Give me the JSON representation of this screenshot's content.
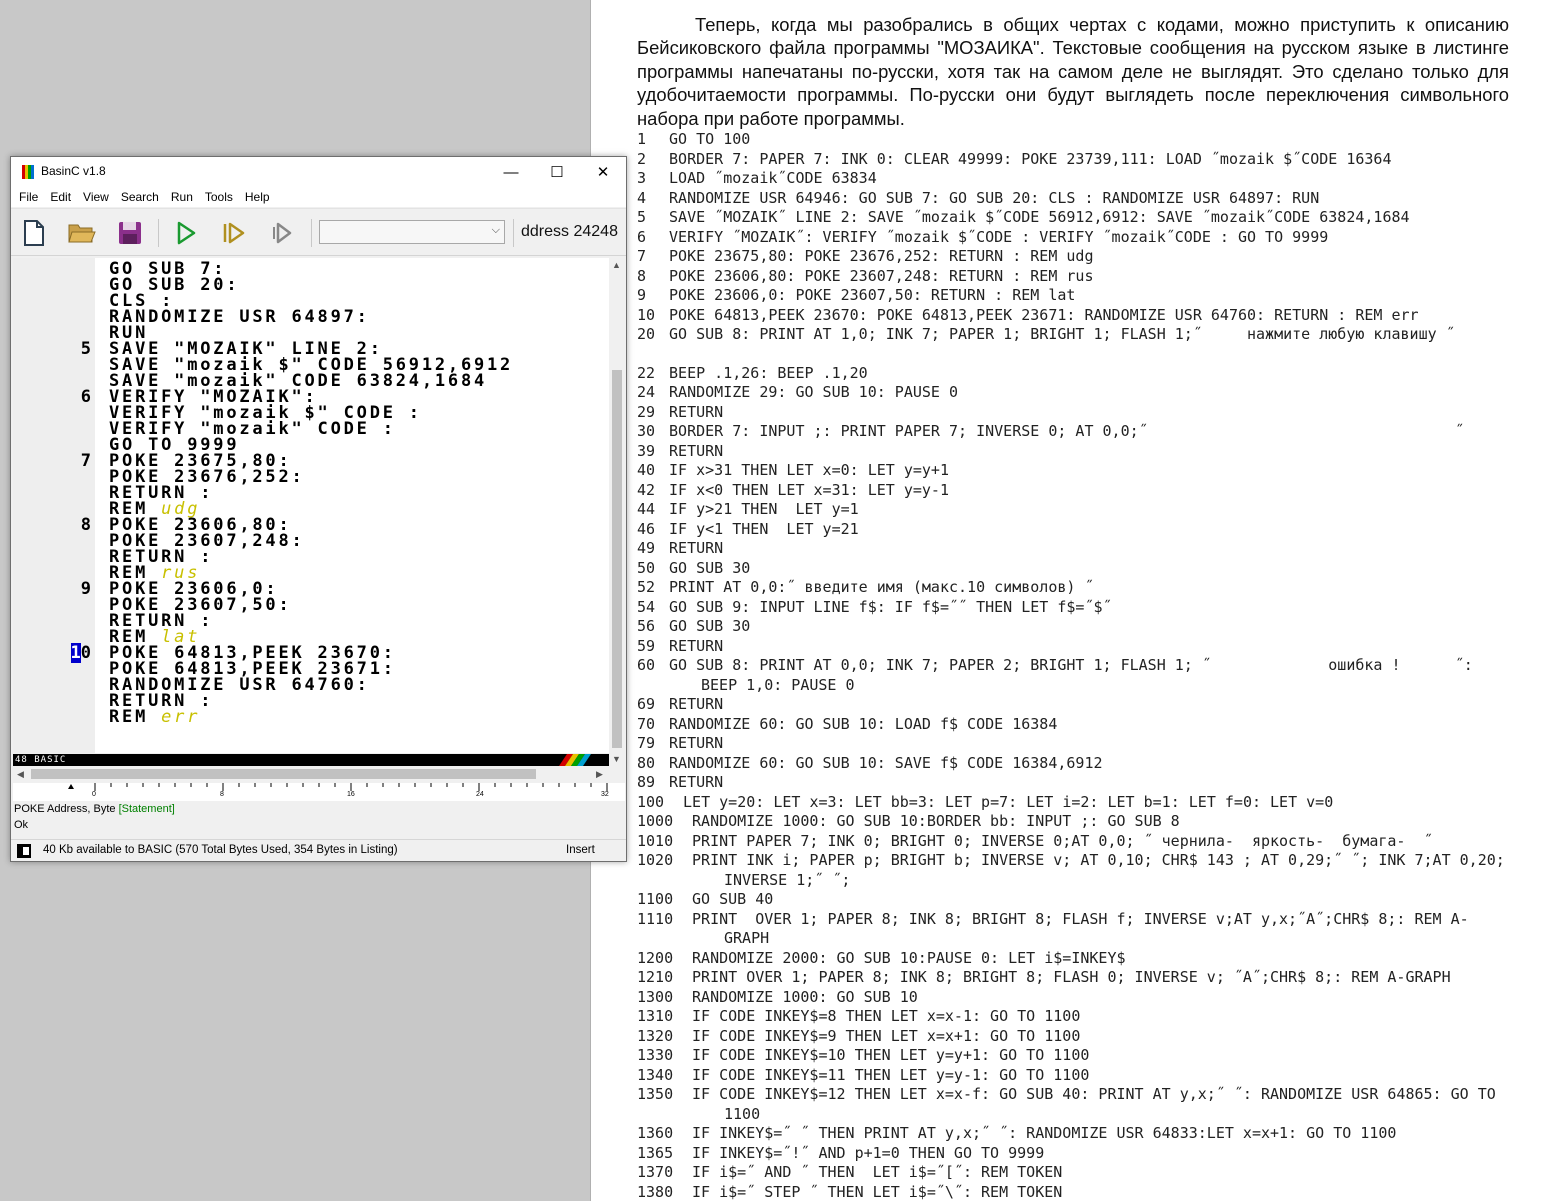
{
  "document": {
    "paragraph": "Теперь, когда мы разобрались в общих чертах с кодами, можно приступить к описанию Бейсиковского файла программы \"МОЗАИКА\". Текстовые сообщения на русском языке в листинге программы напечатаны по-русски, хотя так на самом деле не выглядят. Это сделано только для удобочитаемости программы. По-русски они будут выглядеть после переключения символьного набора при работе программы.",
    "listing": [
      {
        "num": "1",
        "text": "GO TO 100"
      },
      {
        "num": "2",
        "text": "BORDER 7: PAPER 7: INK 0: CLEAR 49999: POKE 23739,111: LOAD ˝mozaik $˝CODE 16364"
      },
      {
        "num": "3",
        "text": "LOAD ˝mozaik˝CODE 63834"
      },
      {
        "num": "4",
        "text": "RANDOMIZE USR 64946: GO SUB 7: GO SUB 20: CLS : RANDOMIZE USR 64897: RUN"
      },
      {
        "num": "5",
        "text": "SAVE ˝MOZAIK˝ LINE 2: SAVE ˝mozaik $˝CODE 56912,6912: SAVE ˝mozaik˝CODE 63824,1684"
      },
      {
        "num": "6",
        "text": "VERIFY ˝MOZAIK˝: VERIFY ˝mozaik $˝CODE : VERIFY ˝mozaik˝CODE : GO TO 9999"
      },
      {
        "num": "7",
        "text": "POKE 23675,80: POKE 23676,252: RETURN : REM udg"
      },
      {
        "num": "8",
        "text": "POKE 23606,80: POKE 23607,248: RETURN : REM rus"
      },
      {
        "num": "9",
        "text": "POKE 23606,0: POKE 23607,50: RETURN : REM lat"
      },
      {
        "num": "10",
        "text": "POKE 64813,PEEK 23670: POKE 64813,PEEK 23671: RANDOMIZE USR 64760: RETURN : REM err"
      },
      {
        "num": "20",
        "text": "GO SUB 8: PRINT AT 1,0; INK 7; PAPER 1; BRIGHT 1; FLASH 1;˝     нажмите любую клавишу ˝"
      },
      {
        "num": "22",
        "text": "BEEP .1,26: BEEP .1,20",
        "gap": true
      },
      {
        "num": "24",
        "text": "RANDOMIZE 29: GO SUB 10: PAUSE 0"
      },
      {
        "num": "29",
        "text": "RETURN"
      },
      {
        "num": "30",
        "text": "BORDER 7: INPUT ;: PRINT PAPER 7; INVERSE 0; AT 0,0;˝                                  ˝"
      },
      {
        "num": "39",
        "text": "RETURN"
      },
      {
        "num": "40",
        "text": "IF x>31 THEN LET x=0: LET y=y+1"
      },
      {
        "num": "42",
        "text": "IF x<0 THEN LET x=31: LET y=y-1"
      },
      {
        "num": "44",
        "text": "IF y>21 THEN  LET y=1"
      },
      {
        "num": "46",
        "text": "IF y<1 THEN  LET y=21"
      },
      {
        "num": "49",
        "text": "RETURN"
      },
      {
        "num": "50",
        "text": "GO SUB 30"
      },
      {
        "num": "52",
        "text": "PRINT AT 0,0:˝ введите имя (макс.10 символов) ˝"
      },
      {
        "num": "54",
        "text": "GO SUB 9: INPUT LINE f$: IF f$=˝˝ THEN LET f$=˝$˝"
      },
      {
        "num": "56",
        "text": "GO SUB 30"
      },
      {
        "num": "59",
        "text": "RETURN"
      },
      {
        "num": "60",
        "text": "GO SUB 8: PRINT AT 0,0; INK 7; PAPER 2; BRIGHT 1; FLASH 1; ˝             ошибка !      ˝: BEEP 1,0: PAUSE 0"
      },
      {
        "num": "69",
        "text": "RETURN"
      },
      {
        "num": "70",
        "text": "RANDOMIZE 60: GO SUB 10: LOAD f$ CODE 16384"
      },
      {
        "num": "79",
        "text": "RETURN"
      },
      {
        "num": "80",
        "text": "RANDOMIZE 60: GO SUB 10: SAVE f$ CODE 16384,6912"
      },
      {
        "num": "89",
        "text": "RETURN"
      },
      {
        "num": "100",
        "text": "LET y=20: LET x=3: LET bb=3: LET p=7: LET i=2: LET b=1: LET f=0: LET v=0"
      },
      {
        "num": "1000",
        "text": "RANDOMIZE 1000: GO SUB 10:BORDER bb: INPUT ;: GO SUB 8"
      },
      {
        "num": "1010",
        "text": "PRINT PAPER 7; INK 0; BRIGHT 0; INVERSE 0;AT 0,0; ˝ чернила-  яркость-  бумага-  ˝"
      },
      {
        "num": "1020",
        "text": "PRINT INK i; PAPER p; BRIGHT b; INVERSE v; AT 0,10; CHR$ 143 ; AT 0,29;˝ ˝; INK 7;AT 0,20; INVERSE 1;˝ ˝;"
      },
      {
        "num": "1100",
        "text": "GO SUB 40"
      },
      {
        "num": "1110",
        "text": "PRINT  OVER 1; PAPER 8; INK 8; BRIGHT 8; FLASH f; INVERSE v;AT y,x;˝A˝;CHR$ 8;: REM A-GRAPH"
      },
      {
        "num": "1200",
        "text": "RANDOMIZE 2000: GO SUB 10:PAUSE 0: LET i$=INKEY$"
      },
      {
        "num": "1210",
        "text": "PRINT OVER 1; PAPER 8; INK 8; BRIGHT 8; FLASH 0; INVERSE v; ˝A˝;CHR$ 8;: REM A-GRAPH"
      },
      {
        "num": "1300",
        "text": "RANDOMIZE 1000: GO SUB 10"
      },
      {
        "num": "1310",
        "text": "IF CODE INKEY$=8 THEN LET x=x-1: GO TO 1100"
      },
      {
        "num": "1320",
        "text": "IF CODE INKEY$=9 THEN LET x=x+1: GO TO 1100"
      },
      {
        "num": "1330",
        "text": "IF CODE INKEY$=10 THEN LET y=y+1: GO TO 1100"
      },
      {
        "num": "1340",
        "text": "IF CODE INKEY$=11 THEN LET y=y-1: GO TO 1100"
      },
      {
        "num": "1350",
        "text": "IF CODE INKEY$=12 THEN LET x=x-f: GO SUB 40: PRINT AT y,x;˝ ˝: RANDOMIZE USR 64865: GO TO 1100"
      },
      {
        "num": "1360",
        "text": "IF INKEY$=˝ ˝ THEN PRINT AT y,x;˝ ˝: RANDOMIZE USR 64833:LET x=x+1: GO TO 1100"
      },
      {
        "num": "1365",
        "text": "IF INKEY$=˝!˝ AND p+1=0 THEN GO TO 9999"
      },
      {
        "num": "1370",
        "text": "IF i$=˝ AND ˝ THEN  LET i$=˝[˝: REM TOKEN"
      },
      {
        "num": "1380",
        "text": "IF i$=˝ STEP ˝ THEN LET i$=˝\\˝: REM TOKEN"
      }
    ]
  },
  "window": {
    "title": "BasinC v1.8",
    "controls": {
      "minimize": "—",
      "maximize": "☐",
      "close": "✕"
    },
    "menu": [
      "File",
      "Edit",
      "View",
      "Search",
      "Run",
      "Tools",
      "Help"
    ],
    "address_display": "ddress 24248",
    "editor_lines": [
      {
        "num": "",
        "text": "GO SUB 7:"
      },
      {
        "num": "",
        "text": "GO SUB 20:"
      },
      {
        "num": "",
        "text": "CLS :"
      },
      {
        "num": "",
        "text": "RANDOMIZE USR 64897:"
      },
      {
        "num": "",
        "text": "RUN"
      },
      {
        "num": "5",
        "text": "SAVE \"MOZAIK\" LINE 2:"
      },
      {
        "num": "",
        "text": "SAVE \"mozaik $\" CODE 56912,6912"
      },
      {
        "num": "",
        "text": "SAVE \"mozaik\" CODE 63824,1684"
      },
      {
        "num": "6",
        "text": "VERIFY \"MOZAIK\":"
      },
      {
        "num": "",
        "text": "VERIFY \"mozaik $\" CODE :"
      },
      {
        "num": "",
        "text": "VERIFY \"mozaik\" CODE :"
      },
      {
        "num": "",
        "text": "GO TO 9999"
      },
      {
        "num": "7",
        "text": "POKE 23675,80:"
      },
      {
        "num": "",
        "text": "POKE 23676,252:"
      },
      {
        "num": "",
        "text": "RETURN :"
      },
      {
        "num": "",
        "text": "REM ",
        "rem": "udg"
      },
      {
        "num": "8",
        "text": "POKE 23606,80:"
      },
      {
        "num": "",
        "text": "POKE 23607,248:"
      },
      {
        "num": "",
        "text": "RETURN :"
      },
      {
        "num": "",
        "text": "REM ",
        "rem": "rus"
      },
      {
        "num": "9",
        "text": "POKE 23606,0:"
      },
      {
        "num": "",
        "text": "POKE 23607,50:"
      },
      {
        "num": "",
        "text": "RETURN :"
      },
      {
        "num": "",
        "text": "REM ",
        "rem": "lat"
      },
      {
        "num": "10",
        "text": "POKE 64813,PEEK 23670:",
        "cursor": true
      },
      {
        "num": "",
        "text": "POKE 64813,PEEK 23671:"
      },
      {
        "num": "",
        "text": "RANDOMIZE USR 64760:"
      },
      {
        "num": "",
        "text": "RETURN :"
      },
      {
        "num": "",
        "text": "REM ",
        "rem": "err"
      }
    ],
    "mode_label": "48 BASIC",
    "ruler_labels": [
      "0",
      "8",
      "16",
      "24",
      "32"
    ],
    "help_syntax": "POKE Address, Byte",
    "help_kind": "[Statement]",
    "help_result": "Ok",
    "status_text": "40 Kb available to BASIC (570 Total Bytes Used, 354 Bytes in Listing)",
    "status_mode": "Insert",
    "colors": {
      "rem_text": "#c8c000",
      "cursor_bg": "#0000cc",
      "help_statement": "#008000"
    }
  }
}
